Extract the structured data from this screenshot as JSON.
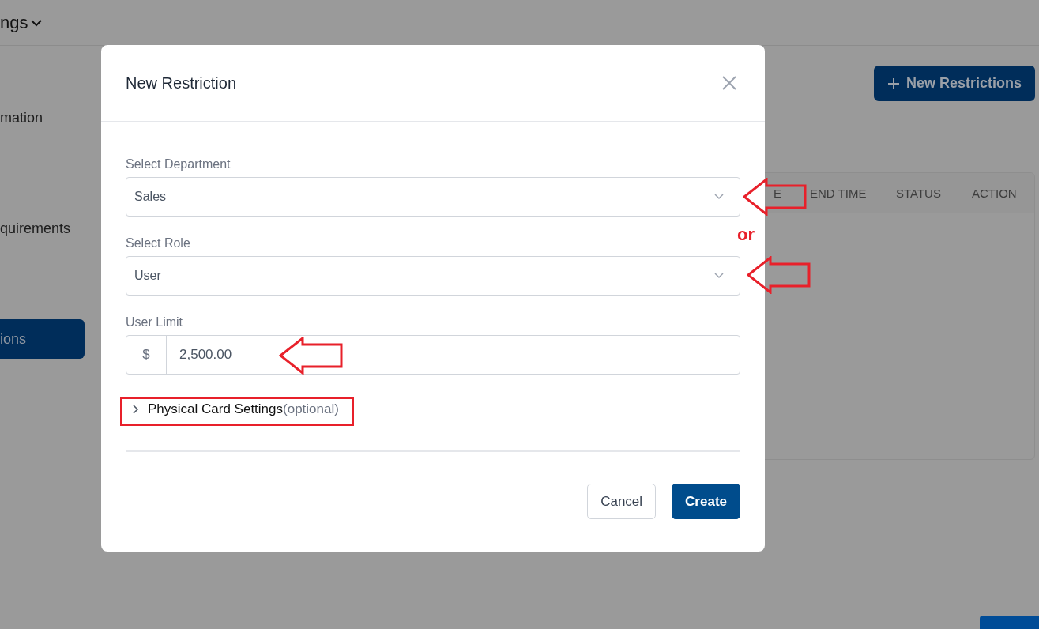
{
  "header": {
    "title": "ngs"
  },
  "sidebar": {
    "items": [
      {
        "label": "mation",
        "selected": false
      },
      {
        "label": "quirements",
        "selected": false
      },
      {
        "label": "ions",
        "selected": true
      }
    ]
  },
  "new_button": {
    "label": "New Restrictions"
  },
  "table": {
    "columns": [
      "E",
      "END TIME",
      "STATUS",
      "ACTION"
    ]
  },
  "modal": {
    "title": "New Restriction",
    "fields": [
      {
        "kind": "select",
        "label": "Select Department",
        "value": "Sales"
      },
      {
        "kind": "select",
        "label": "Select Role",
        "value": "User"
      },
      {
        "kind": "money",
        "label": "User Limit",
        "prefix": "$",
        "value": "2,500.00"
      }
    ],
    "collapsible": {
      "label": "Physical Card Settings",
      "hint": "(optional)",
      "expanded": false
    },
    "buttons": [
      {
        "label": "Cancel",
        "kind": "secondary"
      },
      {
        "label": "Create",
        "kind": "primary"
      }
    ]
  },
  "annotations": {
    "or_label": "or"
  }
}
